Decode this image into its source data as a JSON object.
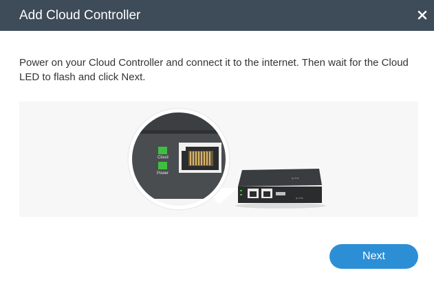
{
  "dialog": {
    "title": "Add Cloud Controller",
    "close_icon": "close-icon",
    "instruction": "Power on your Cloud Controller and connect it to the internet. Then wait for the Cloud LED to flash and click Next.",
    "illustration": {
      "led_labels": {
        "cloud": "Cloud",
        "power": "Power"
      },
      "led_color": "#3fbf3f"
    },
    "next_label": "Next",
    "colors": {
      "header_bg": "#3e4b58",
      "accent": "#2c8fd6",
      "panel_bg": "#f7f7f7"
    }
  }
}
